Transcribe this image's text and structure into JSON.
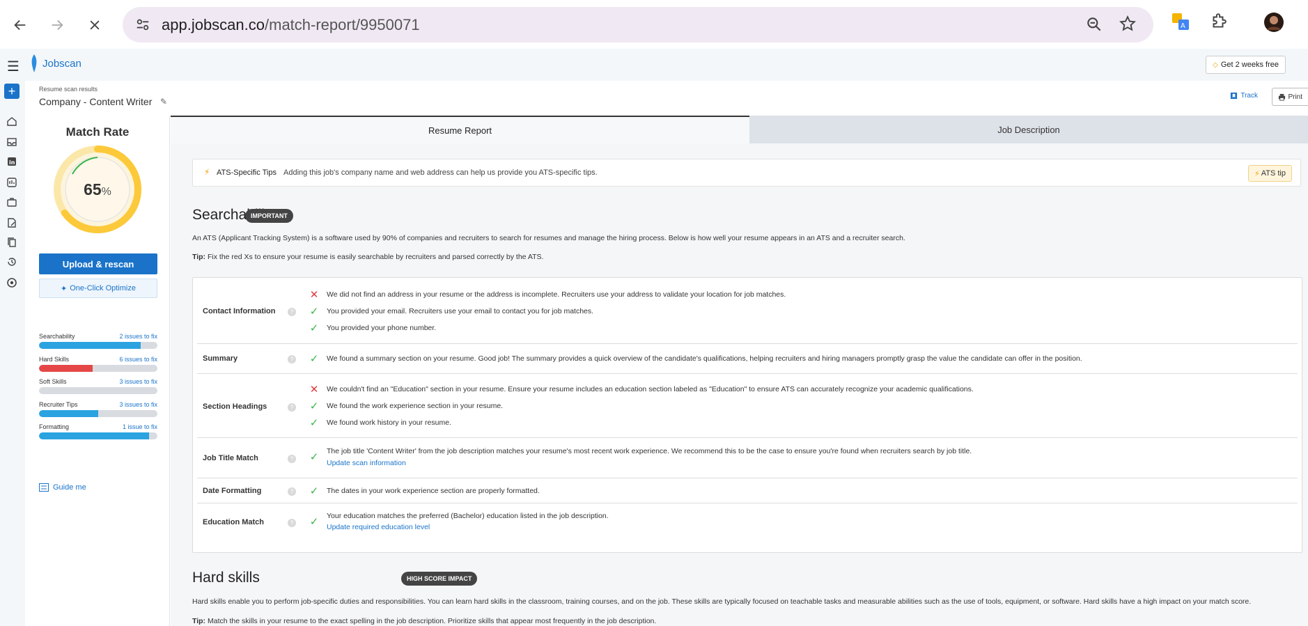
{
  "browser": {
    "url_host": "app.jobscan.co",
    "url_path": "/match-report/9950071"
  },
  "app": {
    "logo_text": "Jobscan",
    "free_button": "Get 2 weeks free"
  },
  "report": {
    "crumb": "Resume scan results",
    "title": "Company - Content Writer",
    "track": "Track",
    "print": "Print"
  },
  "side": {
    "match_rate_title": "Match Rate",
    "match_rate_value": "65",
    "match_rate_unit": "%",
    "match_rate_fraction": 0.65,
    "upload_button": "Upload & rescan",
    "optimize_button": "One-Click Optimize",
    "progress": [
      {
        "name": "Searchability",
        "link": "2 issues to fix",
        "fill": 0.86,
        "color": "#2aa3e0"
      },
      {
        "name": "Hard Skills",
        "link": "6 issues to fix",
        "fill": 0.45,
        "color": "#e54747"
      },
      {
        "name": "Soft Skills",
        "link": "3 issues to fix",
        "fill": 0.0,
        "color": "#2aa3e0"
      },
      {
        "name": "Recruiter Tips",
        "link": "3 issues to fix",
        "fill": 0.5,
        "color": "#2aa3e0"
      },
      {
        "name": "Formatting",
        "link": "1 issue to fix",
        "fill": 0.93,
        "color": "#2aa3e0"
      }
    ],
    "guide": "Guide me"
  },
  "tabs": {
    "resume": "Resume Report",
    "jd": "Job Description"
  },
  "tip": {
    "label": "ATS-Specific Tips",
    "text": "Adding this job's company name and web address can help us provide you ATS-specific tips.",
    "button": "ATS tip"
  },
  "searchability": {
    "title": "Searchability",
    "badge": "IMPORTANT",
    "desc": "An ATS (Applicant Tracking System) is a software used by 90% of companies and recruiters to search for resumes and manage the hiring process. Below is how well your resume appears in an ATS and a recruiter search.",
    "tip_label": "Tip:",
    "tip_text": "Fix the red Xs to ensure your resume is easily searchable by recruiters and parsed correctly by the ATS.",
    "rows": {
      "contact": {
        "label": "Contact Information",
        "items": [
          "We did not find an address in your resume or the address is incomplete. Recruiters use your address to validate your location for job matches.",
          "You provided your email. Recruiters use your email to contact you for job matches.",
          "You provided your phone number."
        ]
      },
      "summary": {
        "label": "Summary",
        "items": [
          "We found a summary section on your resume. Good job! The summary provides a quick overview of the candidate's qualifications, helping recruiters and hiring managers promptly grasp the value the candidate can offer in the position."
        ]
      },
      "headings": {
        "label": "Section Headings",
        "items": [
          "We couldn't find an \"Education\" section in your resume. Ensure your resume includes an education section labeled as \"Education\" to ensure ATS can accurately recognize your academic qualifications.",
          "We found the work experience section in your resume.",
          "We found work history in your resume."
        ]
      },
      "jobtitle": {
        "label": "Job Title Match",
        "items": [
          "The job title 'Content Writer' from the job description matches your resume's most recent work experience. We recommend this to be the case to ensure you're found when recruiters search by job title."
        ],
        "link": "Update scan information"
      },
      "date": {
        "label": "Date Formatting",
        "items": [
          "The dates in your work experience section are properly formatted."
        ]
      },
      "education": {
        "label": "Education Match",
        "items": [
          "Your education matches the preferred (Bachelor) education listed in the job description."
        ],
        "link": "Update required education level"
      }
    }
  },
  "hardskills": {
    "title": "Hard skills",
    "badge": "HIGH SCORE IMPACT",
    "desc": "Hard skills enable you to perform job-specific duties and responsibilities. You can learn hard skills in the classroom, training courses, and on the job. These skills are typically focused on teachable tasks and measurable abilities such as the use of tools, equipment, or software. Hard skills have a high impact on your match score.",
    "tip_label": "Tip:",
    "tip_text": "Match the skills in your resume to the exact spelling in the job description. Prioritize skills that appear most frequently in the job description."
  }
}
